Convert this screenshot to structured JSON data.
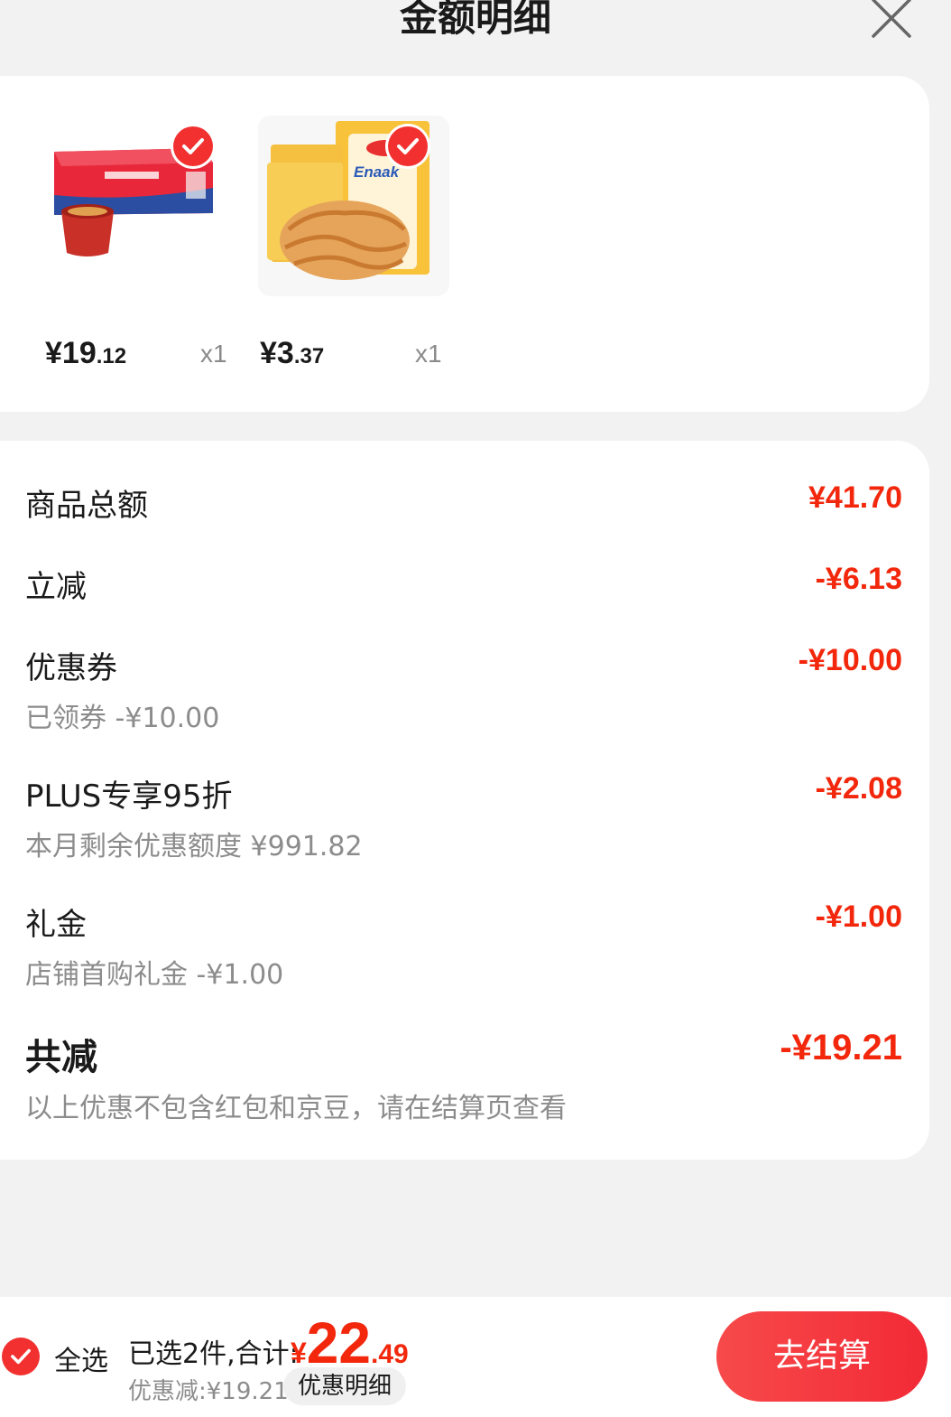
{
  "header": {
    "title": "金额明细"
  },
  "products": [
    {
      "price_yen": "¥",
      "price_int": "19",
      "price_dec": ".12",
      "qty": "x1"
    },
    {
      "price_yen": "¥",
      "price_int": "3",
      "price_dec": ".37",
      "qty": "x1",
      "brand_text": "Enaak"
    }
  ],
  "summary": {
    "rows": [
      {
        "label": "商品总额",
        "value": "¥41.70"
      },
      {
        "label": "立减",
        "value": "-¥6.13"
      },
      {
        "label": "优惠券",
        "value": "-¥10.00",
        "sub": "已领券 -¥10.00"
      },
      {
        "label": "PLUS专享95折",
        "value": "-¥2.08",
        "sub": "本月剩余优惠额度 ¥991.82"
      },
      {
        "label": "礼金",
        "value": "-¥1.00",
        "sub": "店铺首购礼金 -¥1.00"
      }
    ],
    "total": {
      "label": "共减",
      "value": "-¥19.21",
      "sub": "以上优惠不包含红包和京豆，请在结算页查看"
    }
  },
  "bottom": {
    "select_all": "全选",
    "selected": "已选2件,合计:",
    "total_yen": "¥",
    "total_int": "22",
    "total_dec": ".49",
    "discount": "优惠减:¥19.21",
    "discount_detail": "优惠明细",
    "checkout": "去结算"
  },
  "colors": {
    "accent": "#f2270c",
    "check": "#f23030",
    "background": "#f2f2f2"
  },
  "icons": [
    "close-icon",
    "check-icon"
  ]
}
